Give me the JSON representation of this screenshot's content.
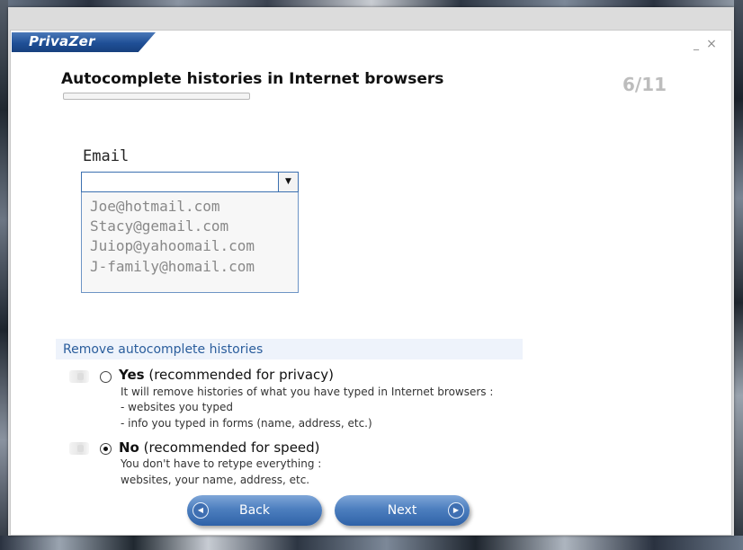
{
  "app": {
    "logo": "PrivaZer",
    "minimize_glyph": "_",
    "close_glyph": "×"
  },
  "page": {
    "title": "Autocomplete histories in Internet browsers",
    "step": "6/11"
  },
  "example": {
    "label": "Email",
    "combo_value": "",
    "combo_arrow": "▼",
    "suggestions": [
      "Joe@hotmail.com",
      "Stacy@gemail.com",
      "Juiop@yahoomail.com",
      "J-family@homail.com"
    ]
  },
  "section": {
    "heading": "Remove autocomplete histories"
  },
  "options": [
    {
      "title": "Yes",
      "qualifier": " (recommended for privacy)",
      "selected": false,
      "desc": [
        "It will remove histories of what you have typed in Internet browsers :",
        "- websites you typed",
        "- info you typed in forms (name, address, etc.)"
      ]
    },
    {
      "title": "No",
      "qualifier": " (recommended for speed)",
      "selected": true,
      "desc": [
        "You don't have to retype everything :",
        "websites, your name, address, etc."
      ]
    }
  ],
  "nav": {
    "back_label": "Back",
    "next_label": "Next",
    "back_icon": "◀",
    "next_icon": "▶"
  },
  "colors": {
    "accent": "#2f62a8",
    "section_text": "#2a5d9c",
    "step_text": "#bdbdbd"
  }
}
